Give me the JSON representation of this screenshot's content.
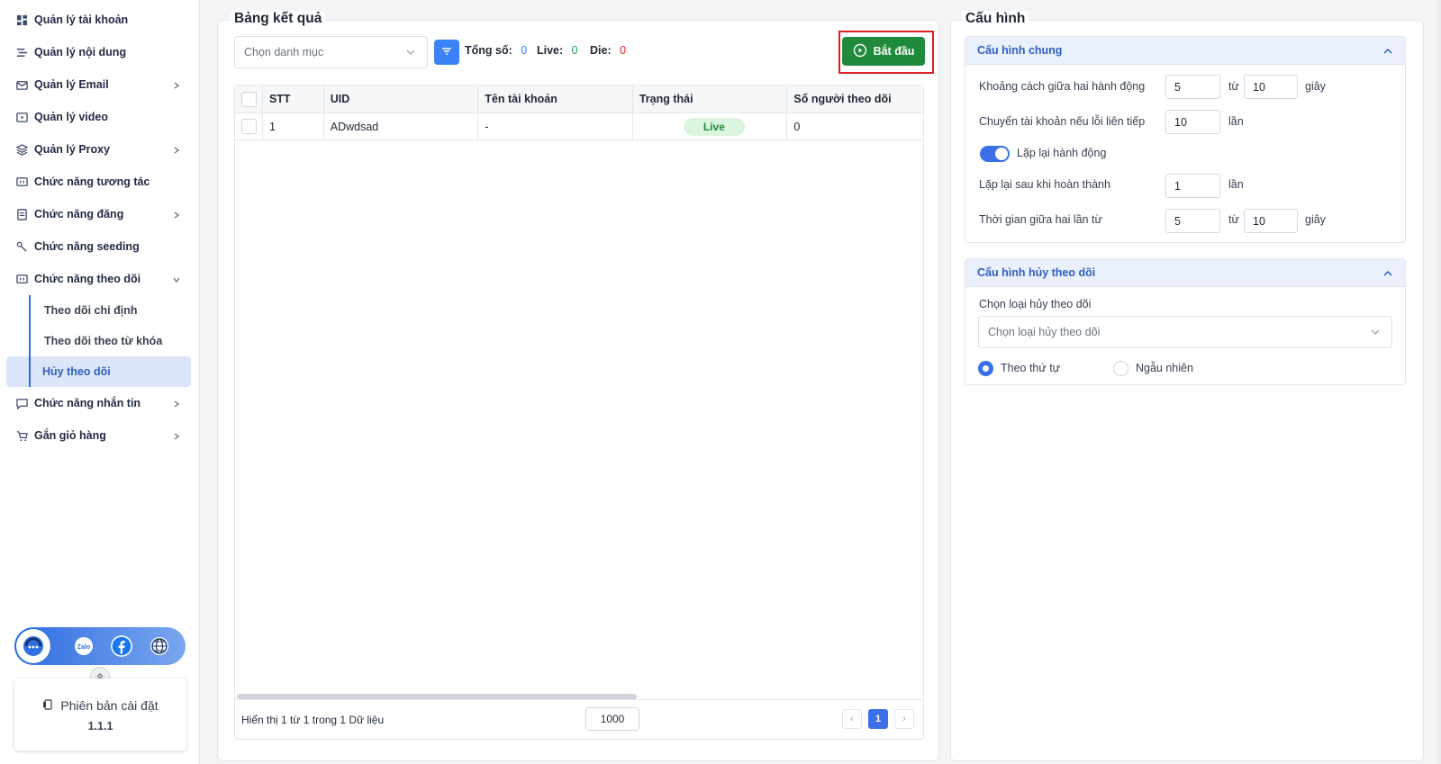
{
  "sidebar": {
    "items": [
      {
        "label": "Quản lý tài khoản",
        "icon": "grid-icon",
        "chevron": ""
      },
      {
        "label": "Quản lý nội dung",
        "icon": "layers-icon",
        "chevron": ""
      },
      {
        "label": "Quản lý Email",
        "icon": "mail-icon",
        "chevron": "right"
      },
      {
        "label": "Quản lý video",
        "icon": "video-icon",
        "chevron": ""
      },
      {
        "label": "Quản lý Proxy",
        "icon": "stack-icon",
        "chevron": "right"
      },
      {
        "label": "Chức năng tương tác",
        "icon": "chat-icon",
        "chevron": ""
      },
      {
        "label": "Chức năng đăng",
        "icon": "post-icon",
        "chevron": "right"
      },
      {
        "label": "Chức năng seeding",
        "icon": "seed-icon",
        "chevron": ""
      },
      {
        "label": "Chức năng theo dõi",
        "icon": "follow-icon",
        "chevron": "down"
      }
    ],
    "sub_items": [
      {
        "label": "Theo dõi chỉ định"
      },
      {
        "label": "Theo dõi theo từ khóa"
      },
      {
        "label": "Hủy theo dõi",
        "active": true
      }
    ],
    "items_after": [
      {
        "label": "Chức năng nhắn tin",
        "icon": "message-icon",
        "chevron": "right"
      },
      {
        "label": "Gắn giỏ hàng",
        "icon": "cart-icon",
        "chevron": "right"
      }
    ],
    "version_label": "Phiên bản cài đặt",
    "version_number": "1.1.1"
  },
  "results": {
    "title": "Bảng kết quả",
    "category_placeholder": "Chọn danh mục",
    "total_label": "Tổng số:",
    "total_value": "0",
    "live_label": "Live:",
    "live_value": "0",
    "die_label": "Die:",
    "die_value": "0",
    "start_label": "Bắt đầu",
    "columns": [
      "STT",
      "UID",
      "Tên tài khoản",
      "Trạng thái",
      "Số người theo dõi"
    ],
    "rows": [
      {
        "stt": "1",
        "uid": "ADwdsad",
        "name": "-",
        "status": "Live",
        "followers": "0"
      }
    ],
    "footer_text": "Hiển thị 1 từ 1 trong 1 Dữ liệu",
    "page_size": "1000",
    "current_page": "1",
    "prev_symbol": "‹",
    "next_symbol": "›"
  },
  "config": {
    "title": "Cấu hình",
    "general": {
      "title": "Cấu hình chung",
      "delay_label": "Khoảng cách giữa hai hành động",
      "delay_from": "5",
      "delay_to_label": "từ",
      "delay_to": "10",
      "delay_unit": "giây",
      "switch_label": "Chuyển tài khoản nếu lỗi liên tiếp",
      "switch_value": "10",
      "switch_unit": "lần",
      "repeat_label": "Lặp lại hành động",
      "repeat_after_label": "Lặp lại sau khi hoàn thành",
      "repeat_after_value": "1",
      "repeat_after_unit": "lần",
      "between_label": "Thời gian giữa hai lần từ",
      "between_from": "5",
      "between_to_label": "từ",
      "between_to": "10",
      "between_unit": "giây"
    },
    "unfollow": {
      "title": "Cấu hình hủy theo dõi",
      "type_label": "Chọn loại hủy theo dõi",
      "type_placeholder": "Chọn loại hủy theo dõi",
      "order_label": "Theo thứ tự",
      "random_label": "Ngẫu nhiên"
    }
  },
  "colors": {
    "accent": "#3b6fe8",
    "start_green": "#1f8a3b",
    "highlight_red": "#e11d25"
  }
}
